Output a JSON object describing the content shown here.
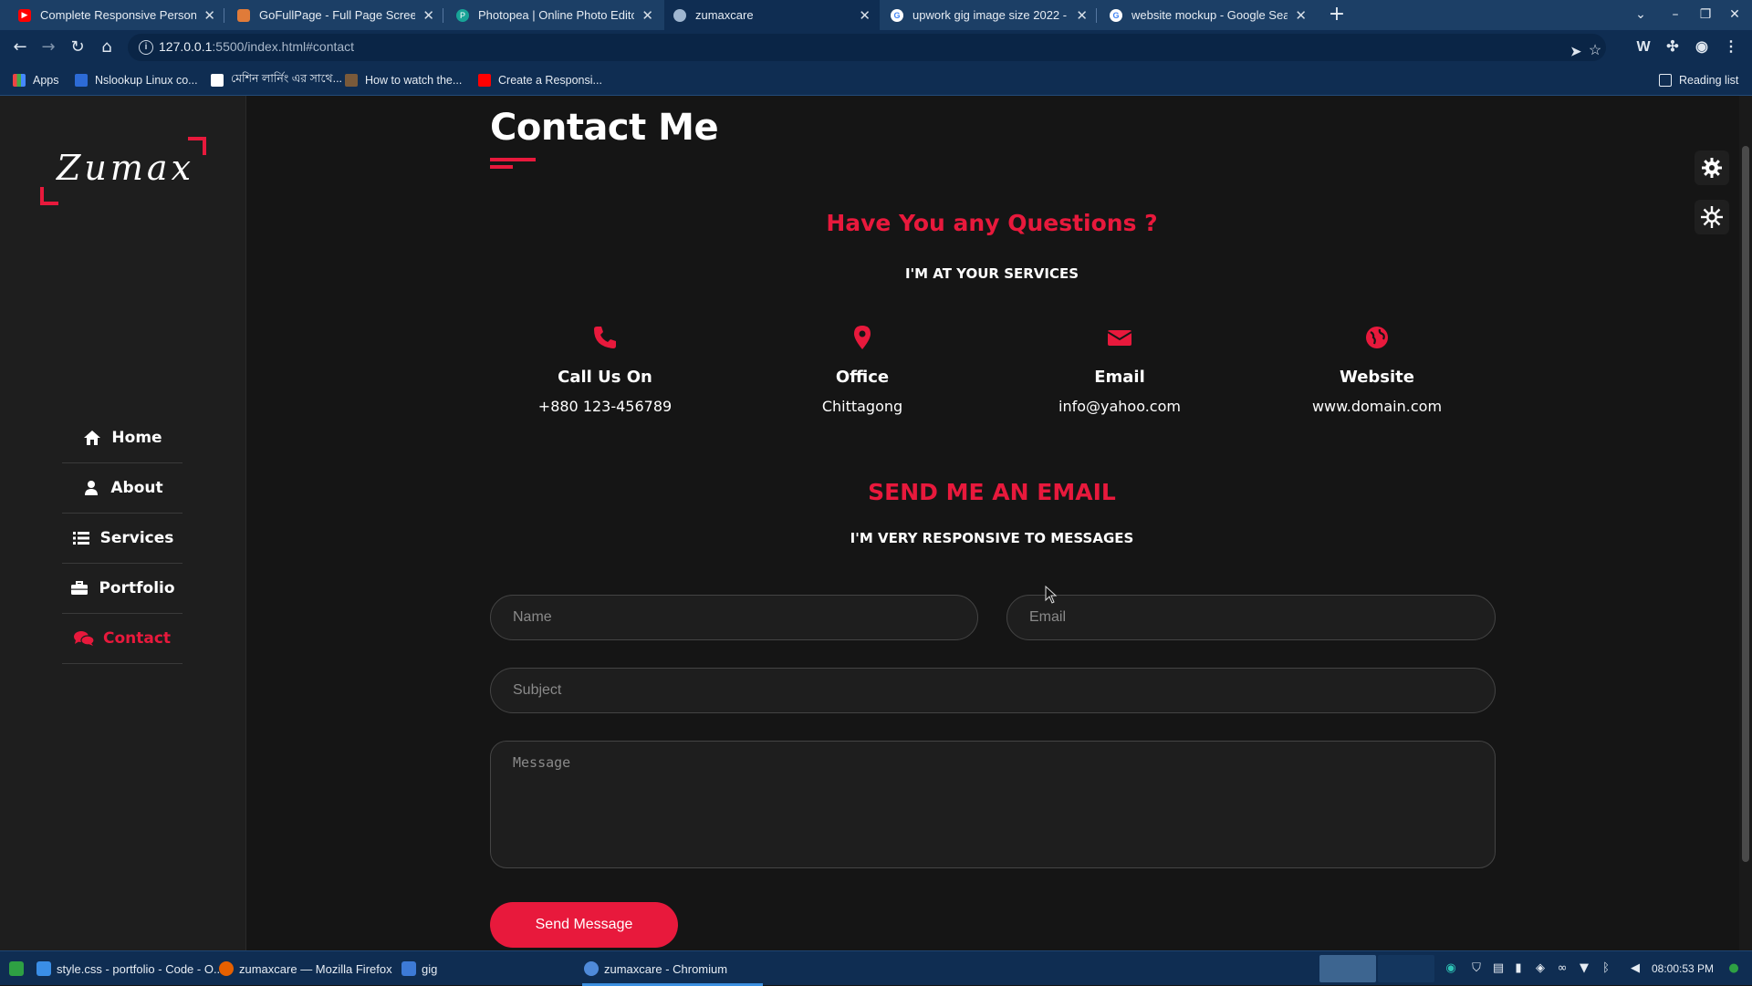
{
  "browser": {
    "tabs": [
      {
        "label": "Complete Responsive Personal",
        "icon": "youtube-icon",
        "color": "#ff0000"
      },
      {
        "label": "GoFullPage - Full Page Screen C",
        "icon": "gofullpage-icon",
        "color": "#e07b39"
      },
      {
        "label": "Photopea | Online Photo Editor",
        "icon": "photopea-icon",
        "color": "#18a497"
      },
      {
        "label": "zumaxcare",
        "icon": "globe-icon",
        "color": "#9fb6d0"
      },
      {
        "label": "upwork gig image size 2022 - G",
        "icon": "google-icon",
        "color": "#4285f4"
      },
      {
        "label": "website mockup - Google Searc",
        "icon": "google-icon",
        "color": "#4285f4"
      }
    ],
    "active_tab": 3,
    "url_host": "127.0.0.1",
    "url_rest": ":5500/index.html#contact",
    "bookmarks": [
      {
        "label": "Apps"
      },
      {
        "label": "Nslookup Linux co..."
      },
      {
        "label": "মেশিন লার্নিং এর সাথে..."
      },
      {
        "label": "How to watch the..."
      },
      {
        "label": "Create a Responsi..."
      }
    ],
    "reading_list": "Reading list"
  },
  "sidebar": {
    "logo": "Zumax",
    "nav": [
      {
        "label": "Home",
        "icon": "home-icon"
      },
      {
        "label": "About",
        "icon": "user-icon"
      },
      {
        "label": "Services",
        "icon": "list-icon"
      },
      {
        "label": "Portfolio",
        "icon": "briefcase-icon"
      },
      {
        "label": "Contact",
        "icon": "comments-icon"
      }
    ],
    "active_nav": 4
  },
  "contact": {
    "title": "Contact Me",
    "question_heading": "Have You any Questions ?",
    "question_sub": "I'M AT YOUR SERVICES",
    "info": [
      {
        "title": "Call Us On",
        "value": "+880 123-456789",
        "icon": "phone-icon"
      },
      {
        "title": "Office",
        "value": "Chittagong",
        "icon": "map-marker-icon"
      },
      {
        "title": "Email",
        "value": "info@yahoo.com",
        "icon": "envelope-icon"
      },
      {
        "title": "Website",
        "value": "www.domain.com",
        "icon": "globe-icon"
      }
    ],
    "email_heading": "SEND ME AN EMAIL",
    "email_sub": "I'M VERY RESPONSIVE TO MESSAGES",
    "form": {
      "name_placeholder": "Name",
      "email_placeholder": "Email",
      "subject_placeholder": "Subject",
      "message_placeholder": "Message",
      "send_label": "Send Message"
    }
  },
  "taskbar": {
    "items": [
      {
        "label": "style.css - portfolio - Code - O..."
      },
      {
        "label": "zumaxcare — Mozilla Firefox"
      },
      {
        "label": "gig"
      },
      {
        "label": "zumaxcare - Chromium"
      }
    ],
    "clock": "08:00:53 PM"
  },
  "colors": {
    "accent": "#e8193c",
    "background": "#151515",
    "sidebar": "#1e1e1e",
    "chrome": "#0f2d52"
  }
}
